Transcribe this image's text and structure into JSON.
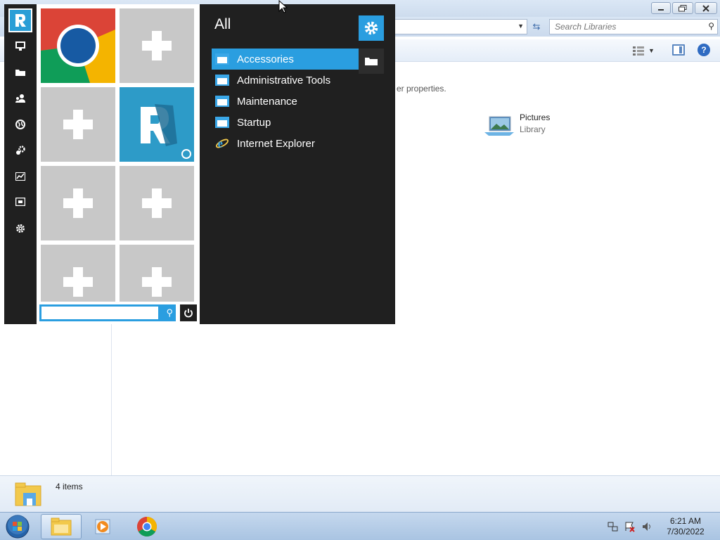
{
  "explorer": {
    "search_placeholder": "Search Libraries",
    "library_description": "er properties.",
    "items": [
      {
        "name": "Pictures",
        "type": "Library"
      }
    ],
    "status": {
      "item_count": "4 items"
    }
  },
  "start_menu": {
    "sidebar": {
      "items": [
        "logo",
        "computer",
        "folder",
        "users",
        "network",
        "settings-gear",
        "performance",
        "display",
        "settings"
      ]
    },
    "tiles": [
      {
        "name": "Google Chrome",
        "icon": "chrome-icon"
      },
      {
        "name": "",
        "icon": "add-tile-icon"
      },
      {
        "name": "",
        "icon": "add-tile-icon"
      },
      {
        "name": "",
        "icon": "app-logo-icon"
      },
      {
        "name": "",
        "icon": "add-tile-icon"
      },
      {
        "name": "",
        "icon": "add-tile-icon"
      },
      {
        "name": "",
        "icon": "add-tile-icon"
      },
      {
        "name": "",
        "icon": "add-tile-icon"
      }
    ],
    "search": {
      "placeholder": ""
    },
    "programs": {
      "heading": "All",
      "items": [
        {
          "label": "Accessories",
          "icon": "folder-icon",
          "selected": true
        },
        {
          "label": "Administrative Tools",
          "icon": "folder-icon",
          "selected": false
        },
        {
          "label": "Maintenance",
          "icon": "folder-icon",
          "selected": false
        },
        {
          "label": "Startup",
          "icon": "folder-icon",
          "selected": false
        },
        {
          "label": "Internet Explorer",
          "icon": "internet-explorer-icon",
          "selected": false
        }
      ]
    }
  },
  "taskbar": {
    "clock": {
      "time": "6:21 AM",
      "date": "7/30/2022"
    },
    "tray_icons": [
      "network-icon",
      "action-center-icon",
      "volume-icon"
    ]
  },
  "colors": {
    "accent": "#2a9ee0",
    "menu_background": "#202020",
    "tile_placeholder": "#c8c8c8"
  }
}
